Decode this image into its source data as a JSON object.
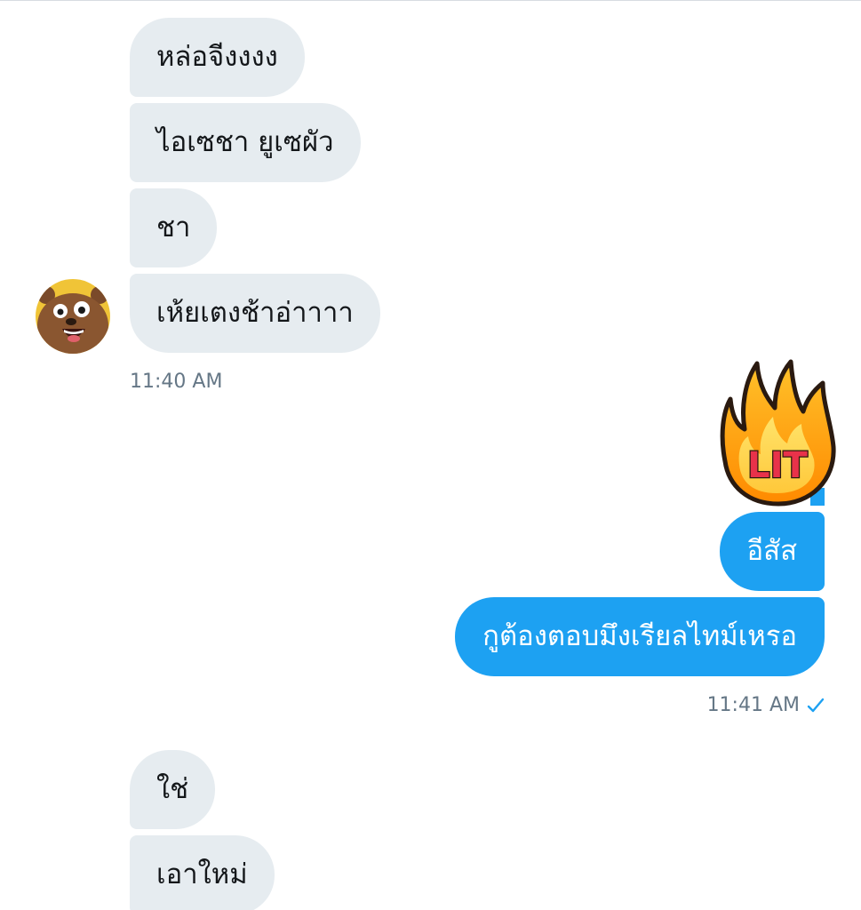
{
  "conversation": {
    "received_group_1": {
      "messages": [
        "หล่อจีงงงง",
        "ไอเซชา ยูเซผัว",
        "ชา",
        "เห้ยเตงช้าอ่าาาา"
      ],
      "timestamp": "11:40 AM"
    },
    "sent_group": {
      "sticker": {
        "text": "LIT",
        "icon": "fire-lit-sticker"
      },
      "messages": [
        "อีสัส",
        "กูต้องตอบมึงเรียลไทม์เหรอ"
      ],
      "timestamp": "11:41 AM",
      "status_icon": "checkmark-icon"
    },
    "received_group_2": {
      "messages": [
        "ใช่",
        "เอาใหม่"
      ]
    }
  },
  "colors": {
    "incoming_bubble": "#e6ecf0",
    "outgoing_bubble": "#1da1f2",
    "timestamp": "#657786",
    "check": "#1da1f2"
  }
}
